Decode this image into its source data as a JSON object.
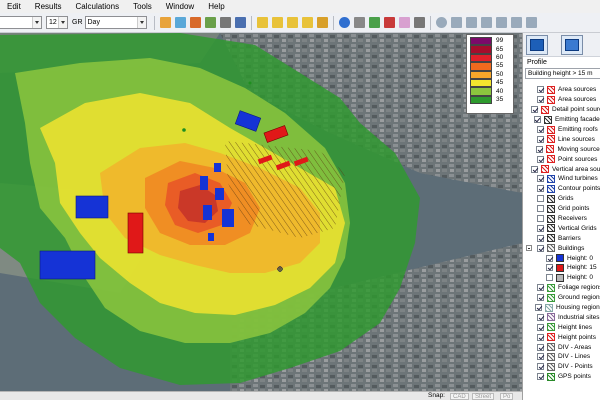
{
  "menu": [
    "Edit",
    "Results",
    "Calculations",
    "Tools",
    "Window",
    "Help"
  ],
  "toolbar": {
    "font_size_value": "12",
    "gr_label": "GR",
    "period_value": "Day"
  },
  "legend": {
    "entries": [
      {
        "value": "99",
        "color": "#7b0a6a"
      },
      {
        "value": "65",
        "color": "#a50d2c"
      },
      {
        "value": "60",
        "color": "#e0202a"
      },
      {
        "value": "55",
        "color": "#f06a1e"
      },
      {
        "value": "50",
        "color": "#f7a62a"
      },
      {
        "value": "45",
        "color": "#f5e52e"
      },
      {
        "value": "40",
        "color": "#8cc63e"
      },
      {
        "value": "35",
        "color": "#2e9a2e"
      }
    ]
  },
  "status": {
    "snap_label": "Snap:",
    "cad_label": "CAD",
    "street_label": "Street",
    "other_label": "Po"
  },
  "panel": {
    "profile_label": "Profile",
    "profile_value": "Building height > 15 m",
    "layers": [
      {
        "label": "Area sources",
        "checked": true,
        "icon": "area-source-icon",
        "color": "#d22",
        "indent": 0
      },
      {
        "label": "Area sources",
        "checked": true,
        "icon": "area-source-star-icon",
        "color": "#d22",
        "indent": 0
      },
      {
        "label": "Detail point sources",
        "checked": true,
        "icon": "detail-point-icon",
        "color": "#d22",
        "indent": 0
      },
      {
        "label": "Emitting facades",
        "checked": true,
        "icon": "emitting-facade-icon",
        "color": "#333",
        "indent": 0
      },
      {
        "label": "Emitting roofs",
        "checked": true,
        "icon": "emitting-roof-icon",
        "color": "#d22",
        "indent": 0
      },
      {
        "label": "Line sources",
        "checked": true,
        "icon": "line-source-icon",
        "color": "#d22",
        "indent": 0
      },
      {
        "label": "Moving sources",
        "checked": true,
        "icon": "moving-source-icon",
        "color": "#d22",
        "indent": 0
      },
      {
        "label": "Point sources",
        "checked": true,
        "icon": "point-source-icon",
        "color": "#d22",
        "indent": 0
      },
      {
        "label": "Vertical area sources",
        "checked": true,
        "icon": "vertical-area-icon",
        "color": "#d22",
        "indent": 0
      },
      {
        "label": "Wind turbines",
        "checked": true,
        "icon": "wind-turbine-icon",
        "color": "#2244aa",
        "indent": 0
      },
      {
        "label": "Contour points",
        "checked": true,
        "icon": "contour-point-icon",
        "color": "#2244aa",
        "indent": 0
      },
      {
        "label": "Grids",
        "checked": false,
        "icon": "grid-icon",
        "color": "#333",
        "indent": 0
      },
      {
        "label": "Grid points",
        "checked": false,
        "icon": "grid-point-icon",
        "color": "#333",
        "indent": 0
      },
      {
        "label": "Receivers",
        "checked": false,
        "icon": "receiver-icon",
        "color": "#333",
        "indent": 0
      },
      {
        "label": "Vertical Grids",
        "checked": true,
        "icon": "vertical-grid-icon",
        "color": "#333",
        "indent": 0
      },
      {
        "label": "Barriers",
        "checked": true,
        "icon": "barrier-icon",
        "color": "#333",
        "indent": 0
      },
      {
        "label": "Buildings",
        "checked": true,
        "icon": "building-icon",
        "color": "#666",
        "indent": 0,
        "expander": true
      },
      {
        "label": "Height: 0",
        "checked": true,
        "icon": "swatch-blue-icon",
        "color": "#1533d6",
        "indent": 1
      },
      {
        "label": "Height: 15",
        "checked": true,
        "icon": "swatch-red-icon",
        "color": "#e01818",
        "indent": 1
      },
      {
        "label": "Height: 0",
        "checked": false,
        "icon": "swatch-gray-icon",
        "color": "#b8b8b8",
        "indent": 1
      },
      {
        "label": "Foliage regions",
        "checked": true,
        "icon": "foliage-icon",
        "color": "#3a9a3a",
        "indent": 0
      },
      {
        "label": "Ground regions",
        "checked": true,
        "icon": "ground-icon",
        "color": "#3a9a3a",
        "indent": 0
      },
      {
        "label": "Housing regions",
        "checked": true,
        "icon": "housing-icon",
        "color": "#8aa",
        "indent": 0
      },
      {
        "label": "Industrial sites",
        "checked": true,
        "icon": "industrial-icon",
        "color": "#8a6a9a",
        "indent": 0
      },
      {
        "label": "Height lines",
        "checked": true,
        "icon": "height-line-icon",
        "color": "#3a9a3a",
        "indent": 0
      },
      {
        "label": "Height points",
        "checked": true,
        "icon": "height-point-icon",
        "color": "#d22",
        "indent": 0
      },
      {
        "label": "DIV - Areas",
        "checked": true,
        "icon": "div-area-icon",
        "color": "#666",
        "indent": 0
      },
      {
        "label": "DIV - Lines",
        "checked": true,
        "icon": "div-line-icon",
        "color": "#666",
        "indent": 0
      },
      {
        "label": "DIV - Points",
        "checked": true,
        "icon": "div-point-icon",
        "color": "#666",
        "indent": 0
      },
      {
        "label": "GPS points",
        "checked": true,
        "icon": "gps-point-icon",
        "color": "#2a8a2a",
        "indent": 0
      }
    ]
  }
}
